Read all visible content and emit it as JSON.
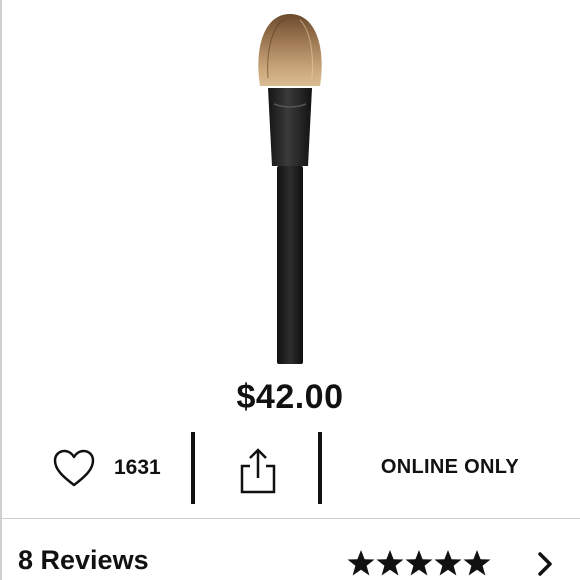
{
  "product": {
    "image_name": "makeup-brush",
    "price": "$42.00",
    "favorites_count": "1631",
    "availability": "ONLINE ONLY"
  },
  "reviews": {
    "label": "8 Reviews",
    "rating": 5,
    "max_rating": 5
  },
  "icons": {
    "favorite": "heart-outline-icon",
    "share": "share-icon",
    "rating": "star-icon",
    "more": "chevron-right-icon"
  },
  "colors": {
    "text": "#111111",
    "divider": "#111111",
    "rule": "#cfcfcf",
    "background": "#ffffff"
  }
}
